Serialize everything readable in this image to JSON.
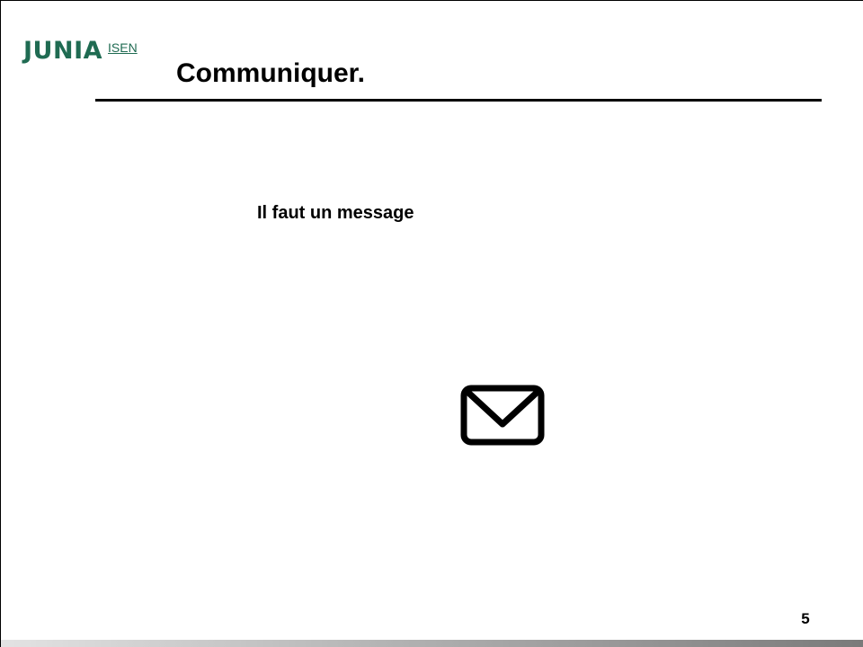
{
  "logo": {
    "brand": "JUNIA",
    "sub": "ISEN"
  },
  "slide": {
    "title": "Communiquer.",
    "body": "Il faut un message",
    "page_number": "5"
  },
  "icons": {
    "envelope": "envelope-icon"
  },
  "colors": {
    "logo": "#1f6b52",
    "text": "#000000",
    "background": "#ffffff"
  }
}
